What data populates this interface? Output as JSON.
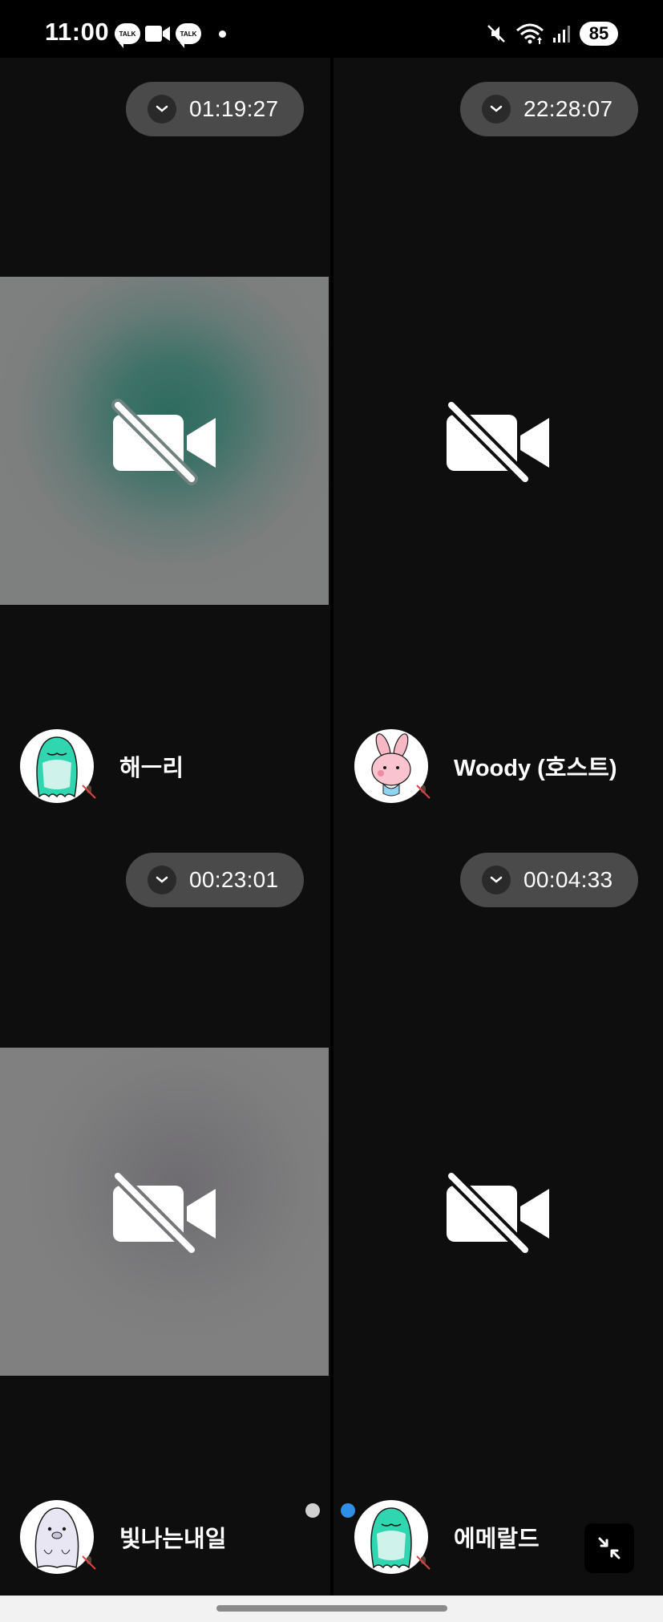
{
  "status_bar": {
    "time": "11:00",
    "notification_icons": [
      "kakaotalk-icon",
      "video-camera-icon",
      "kakaotalk-icon",
      "dot-icon"
    ],
    "talk_label": "TALK",
    "system_icons": [
      "mute-icon",
      "wifi-icon",
      "signal-icon",
      "battery-icon"
    ],
    "battery_level": "85"
  },
  "participants": [
    {
      "name": "해ㅡ리",
      "timer": "01:19:27",
      "video": "teal-blur",
      "avatar": "teal-character"
    },
    {
      "name": "Woody (호스트)",
      "timer": "22:28:07",
      "video": "off-dark",
      "avatar": "pink-rabbit"
    },
    {
      "name": "빛나는내일",
      "timer": "00:23:01",
      "video": "grey-blur",
      "avatar": "white-seal"
    },
    {
      "name": "에메랄드",
      "timer": "00:04:33",
      "video": "off-dark",
      "avatar": "teal-character"
    }
  ],
  "pagination": {
    "total": 2,
    "current": 2
  },
  "colors": {
    "background": "#0e0e0e",
    "pill": "#4a4a4a",
    "active_dot": "#2f8fe6",
    "teal_blur": "#2d6b5e"
  },
  "controls": {
    "minimize": "minimize-icon"
  }
}
